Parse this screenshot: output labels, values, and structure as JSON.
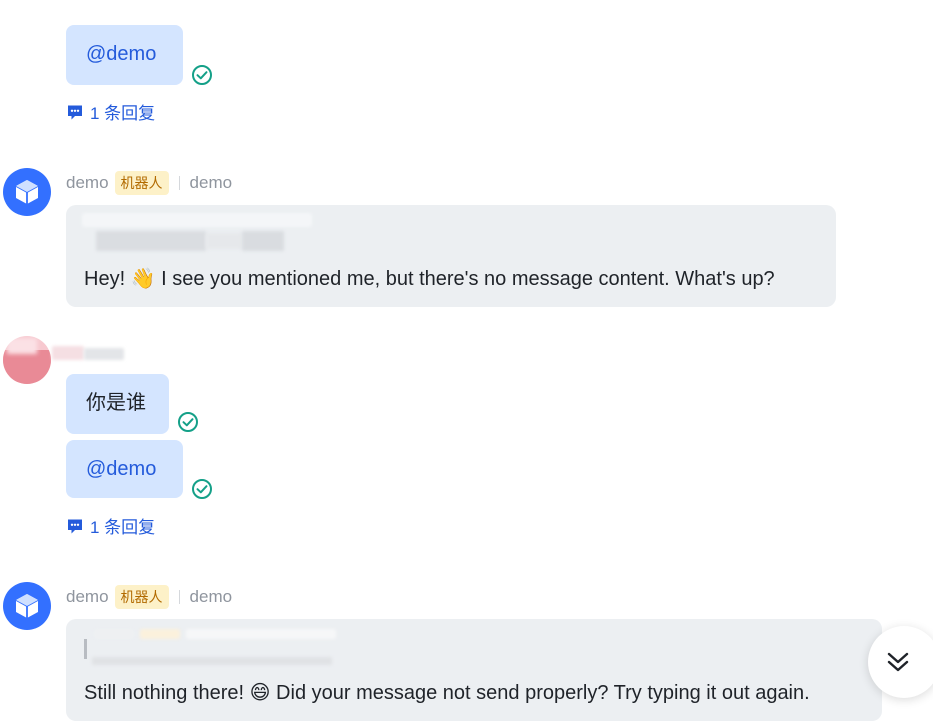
{
  "thread1": {
    "mention_text": "@demo",
    "reply_count_label": "1 条回复"
  },
  "bot_message1": {
    "sender_name": "demo",
    "bot_badge": "机器人",
    "channel_name": "demo",
    "text": "Hey! 👋 I see you mentioned me, but there's no message content. What's up?"
  },
  "user_message": {
    "text1": "你是谁",
    "mention_text": "@demo",
    "reply_count_label": "1 条回复"
  },
  "bot_message2": {
    "sender_name": "demo",
    "bot_badge": "机器人",
    "channel_name": "demo",
    "text": "Still nothing there! 😄 Did your message not send properly? Try typing it out again."
  },
  "colors": {
    "accent_blue": "#245bdb",
    "bubble_blue": "#d4e5ff",
    "bubble_grey": "#eceff2",
    "read_check_green": "#14a088",
    "bot_badge_bg": "#fdf1c8",
    "bot_badge_text": "#b26a00"
  },
  "icons": {
    "read_receipt": "check-circle-icon",
    "reply": "comment-bubble-icon",
    "bot_avatar": "cube-icon",
    "scroll_down": "double-chevron-down-icon"
  }
}
